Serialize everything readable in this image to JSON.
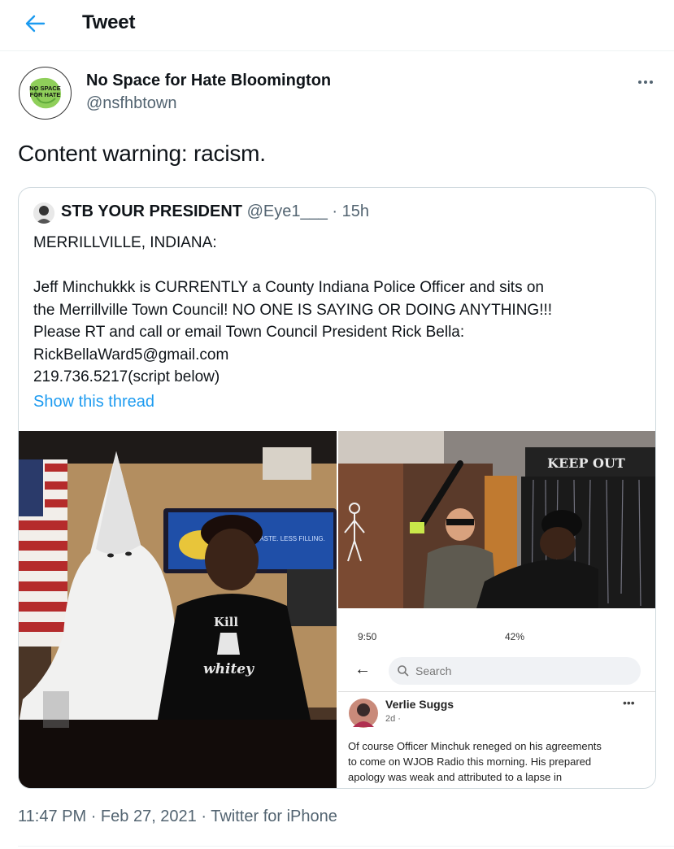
{
  "header": {
    "title": "Tweet",
    "back_icon": "arrow-left-icon"
  },
  "tweet": {
    "author_name": "No Space for Hate Bloomington",
    "author_handle": "@nsfhbtown",
    "avatar_text": [
      "NO SPACE",
      "FOR HATE"
    ],
    "text": "Content warning: racism.",
    "timestamp": "11:47 PM",
    "date": "Feb 27, 2021",
    "source": "Twitter for iPhone",
    "separator": "·"
  },
  "quote": {
    "name": "STB YOUR PRESIDENT",
    "handle": "@Eye1___",
    "dot": "·",
    "time": "15h",
    "lines": [
      "MERRILLVILLE, INDIANA:",
      "",
      "Jeff Minchukkk is CURRENTLY a County Indiana Police Officer and sits on",
      "the Merrillville Town Council! NO ONE IS SAYING OR DOING ANYTHING!!!",
      "Please RT and call or email Town Council President Rick Bella:",
      "RickBellaWard5@gmail.com",
      "219.736.5217(script below)"
    ],
    "show_thread": "Show this thread"
  },
  "media": {
    "photo1": {
      "shirt_text": [
        "Kill",
        "whitey"
      ],
      "sign_text": "GREAT TASTE. LESS FILLING."
    },
    "photo2": {
      "banner_text": "KEEP OUT"
    },
    "phone": {
      "status_left": "9:50",
      "status_right": "42%",
      "search_placeholder": "Search",
      "poster_name": "Verlie Suggs",
      "poster_meta": "2d ·",
      "more": "•••",
      "post_lines": [
        "Of course Officer Minchuk reneged on his agreements",
        "to come on WJOB Radio this morning. His prepared",
        "apology was weak and attributed to a lapse in"
      ]
    }
  },
  "colors": {
    "accent": "#1d9bf0",
    "secondary_text": "#536471",
    "border": "#cfd9de"
  }
}
